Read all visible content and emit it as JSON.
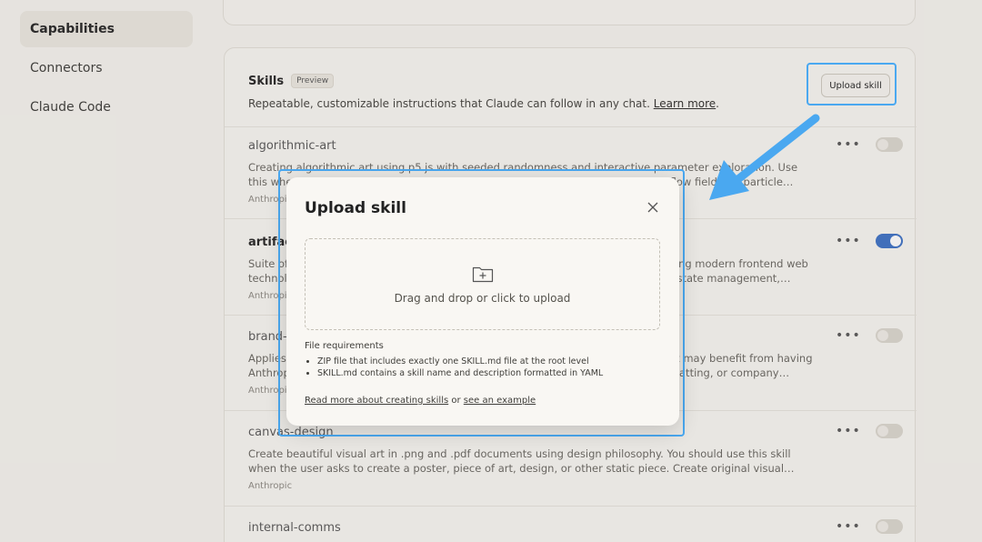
{
  "sidebar": {
    "items": [
      {
        "label": "Capabilities",
        "active": true
      },
      {
        "label": "Connectors",
        "active": false
      },
      {
        "label": "Claude Code",
        "active": false
      }
    ]
  },
  "skills_section": {
    "title": "Skills",
    "badge": "Preview",
    "description": "Repeatable, customizable instructions that Claude can follow in any chat. ",
    "learn_more": "Learn more",
    "upload_button": "Upload skill"
  },
  "skills": [
    {
      "name": "algorithmic-art",
      "description": "Creating algorithmic art using p5.js with seeded randomness and interactive parameter exploration. Use this when users request creating art using code, generative art, algorithmic art, flow fields, or particle systems. Create original algorithmic art rather than copying existing artists' work to avoid copyright violations.",
      "author": "Anthropic",
      "enabled": false
    },
    {
      "name": "artifacts-builder",
      "description": "Suite of tools for creating elaborate, multi-component claude.ai HTML artifacts using modern frontend web technologies (React, Tailwind CSS, shadcn/ui). Use for complex artifacts requiring state management, routing, or shadcn/ui components.",
      "author": "Anthropic",
      "enabled": true
    },
    {
      "name": "brand-guidelines",
      "description": "Applies Anthropic's official brand colors and typography to any sort of artifact that may benefit from having Anthropic's look-and-feel. Use it when brand colors or style guidelines, visual formatting, or company design standards apply.",
      "author": "Anthropic",
      "enabled": false
    },
    {
      "name": "canvas-design",
      "description": "Create beautiful visual art in .png and .pdf documents using design philosophy. You should use this skill when the user asks to create a poster, piece of art, design, or other static piece. Create original visual designs, never copying existing artists' work to avoid copyright violations.",
      "author": "Anthropic",
      "enabled": false
    },
    {
      "name": "internal-comms",
      "description": "",
      "author": "",
      "enabled": false
    }
  ],
  "modal": {
    "title": "Upload skill",
    "dropzone_label": "Drag and drop or click to upload",
    "requirements_title": "File requirements",
    "requirements": [
      "ZIP file that includes exactly one SKILL.md file at the root level",
      "SKILL.md contains a skill name and description formatted in YAML"
    ],
    "link_read_more": "Read more about creating skills",
    "link_or": " or ",
    "link_example": "see an example"
  },
  "colors": {
    "highlight": "#4aa8f0",
    "toggle_on": "#3a6fc4",
    "background": "#f5f3ee"
  }
}
